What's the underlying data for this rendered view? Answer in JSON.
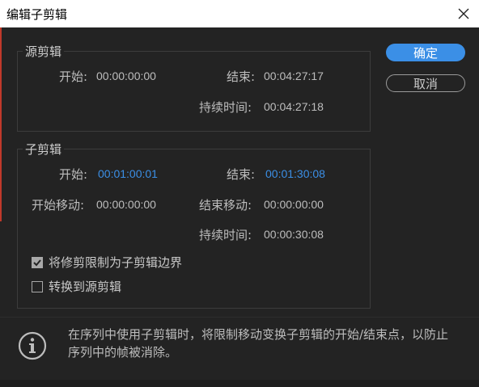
{
  "window": {
    "title": "编辑子剪辑"
  },
  "source_clip": {
    "label": "源剪辑",
    "start_label": "开始:",
    "start_value": "00:00:00:00",
    "end_label": "结束:",
    "end_value": "00:04:27:17",
    "duration_label": "持续时间:",
    "duration_value": "00:04:27:18"
  },
  "sub_clip": {
    "label": "子剪辑",
    "start_label": "开始:",
    "start_value": "00:01:00:01",
    "end_label": "结束:",
    "end_value": "00:01:30:08",
    "start_move_label": "开始移动:",
    "start_move_value": "00:00:00:00",
    "end_move_label": "结束移动:",
    "end_move_value": "00:00:00:00",
    "duration_label": "持续时间:",
    "duration_value": "00:00:30:08",
    "restrict_label": "将修剪限制为子剪辑边界",
    "restrict_checked": true,
    "convert_label": "转换到源剪辑",
    "convert_checked": false
  },
  "buttons": {
    "ok": "确定",
    "cancel": "取消"
  },
  "info": {
    "text": "在序列中使用子剪辑时，将限制移动变换子剪辑的开始/结束点，以防止序列中的帧被消除。"
  },
  "colors": {
    "accent": "#3b8fe6",
    "background": "#232323",
    "text": "#bdbdbd"
  }
}
